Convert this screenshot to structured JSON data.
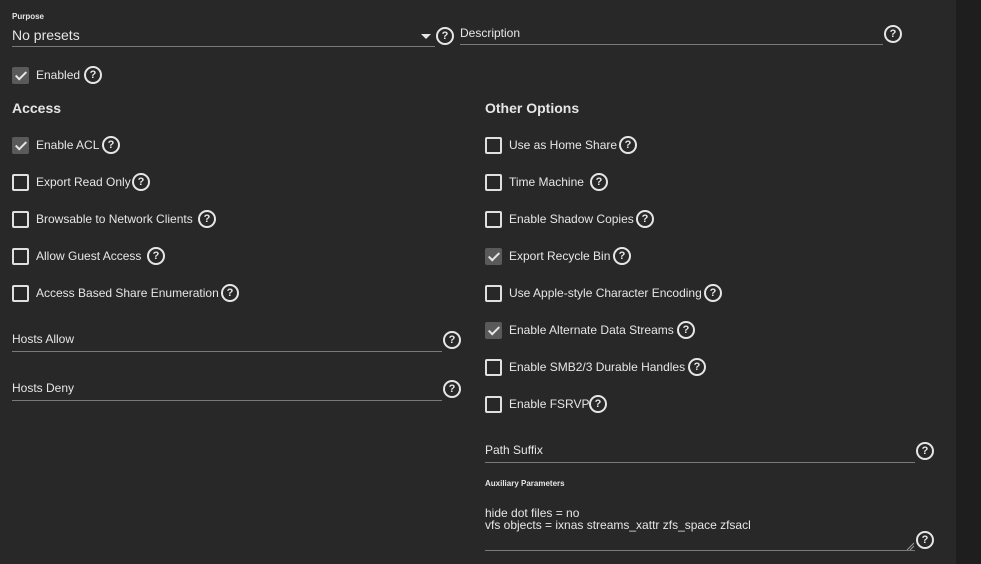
{
  "purpose": {
    "label": "Purpose",
    "value": "No presets"
  },
  "description": {
    "label": "Description"
  },
  "enabled": {
    "label": "Enabled",
    "checked": true
  },
  "access": {
    "title": "Access",
    "options": [
      {
        "label": "Enable ACL",
        "checked": true
      },
      {
        "label": "Export Read Only",
        "checked": false
      },
      {
        "label": "Browsable to Network Clients",
        "checked": false
      },
      {
        "label": "Allow Guest Access",
        "checked": false
      },
      {
        "label": "Access Based Share Enumeration",
        "checked": false
      }
    ],
    "hosts_allow": {
      "label": "Hosts Allow"
    },
    "hosts_deny": {
      "label": "Hosts Deny"
    }
  },
  "other": {
    "title": "Other Options",
    "options": [
      {
        "label": "Use as Home Share",
        "checked": false
      },
      {
        "label": "Time Machine",
        "checked": false
      },
      {
        "label": "Enable Shadow Copies",
        "checked": false
      },
      {
        "label": "Export Recycle Bin",
        "checked": true
      },
      {
        "label": "Use Apple-style Character Encoding",
        "checked": false
      },
      {
        "label": "Enable Alternate Data Streams",
        "checked": true
      },
      {
        "label": "Enable SMB2/3 Durable Handles",
        "checked": false
      },
      {
        "label": "Enable FSRVP",
        "checked": false
      }
    ],
    "path_suffix": {
      "label": "Path Suffix"
    },
    "auxiliary": {
      "label": "Auxiliary Parameters",
      "value": "hide dot files = no\nvfs objects = ixnas streams_xattr zfs_space zfsacl"
    }
  },
  "help_glyph": "?",
  "icons": {
    "help": "help-circle-icon",
    "caret": "caret-down-icon",
    "check": "check-icon"
  }
}
